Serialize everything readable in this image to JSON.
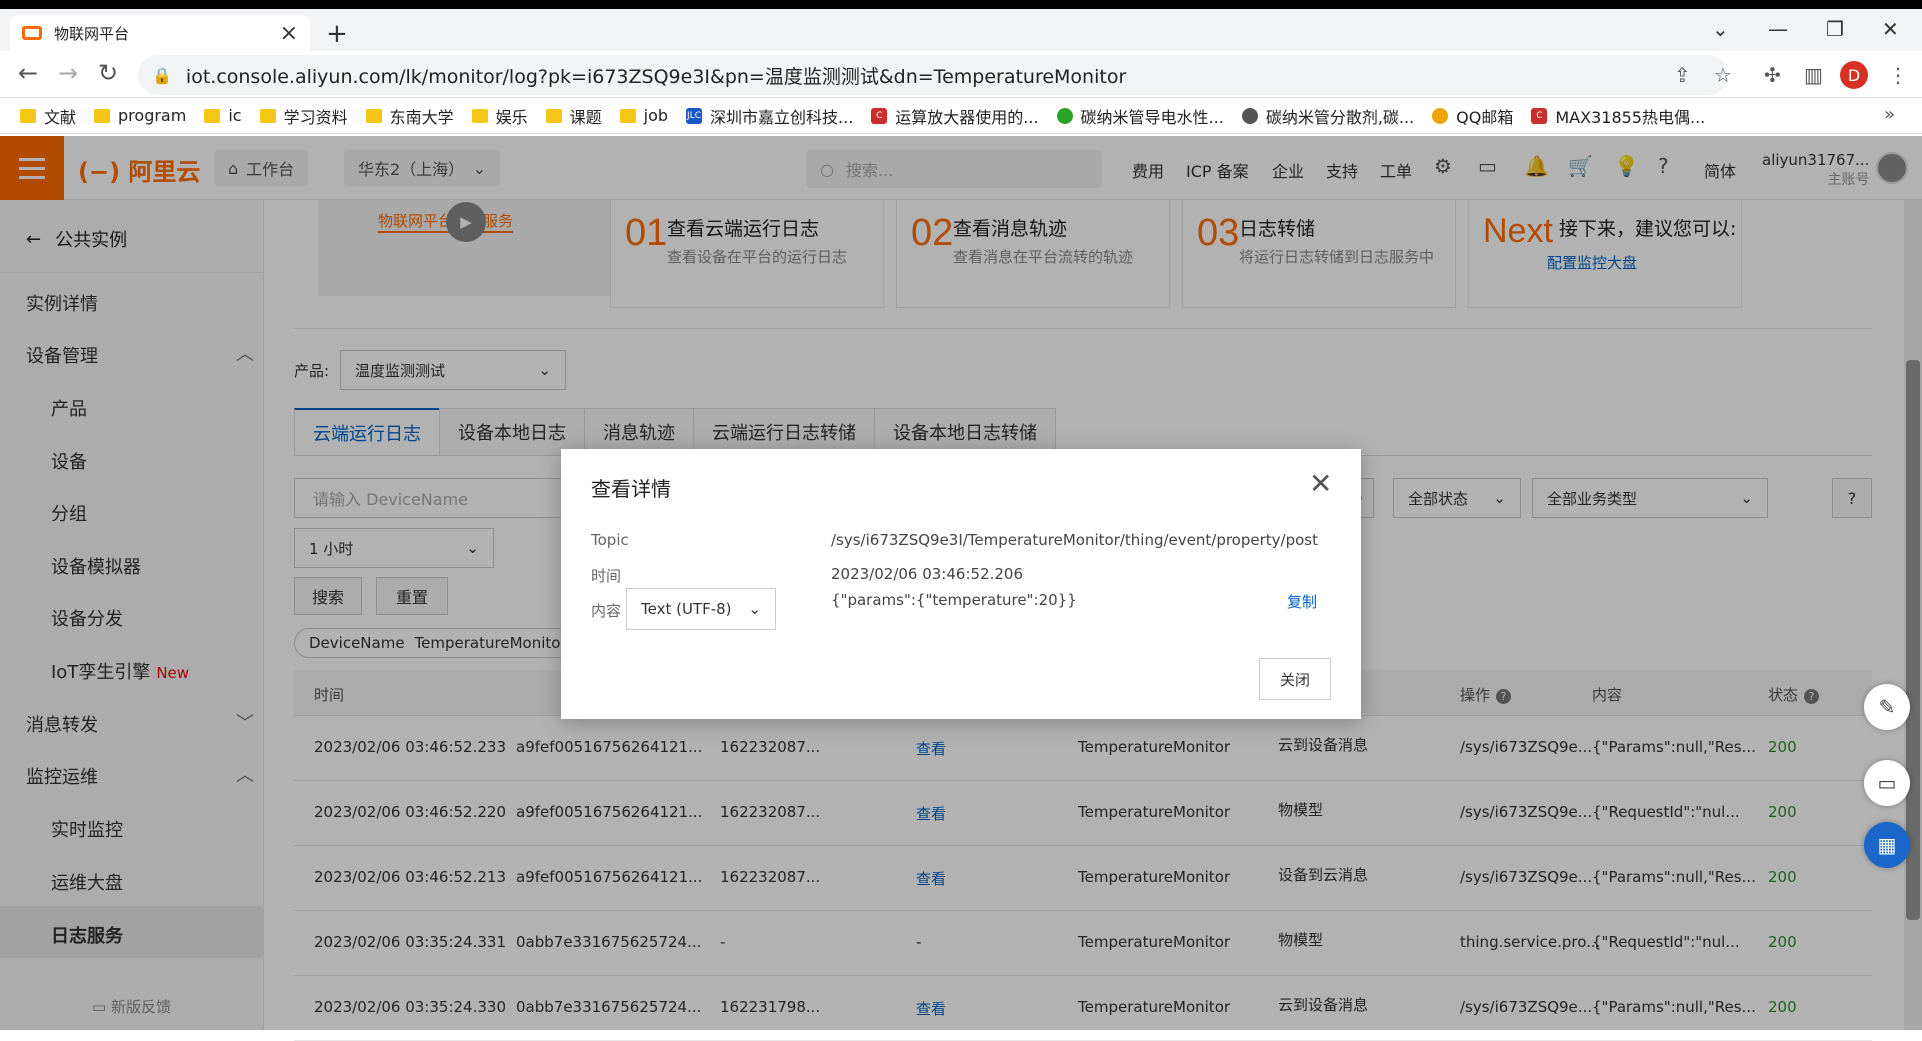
{
  "browser": {
    "tab_title": "物联网平台",
    "url": "iot.console.aliyun.com/lk/monitor/log?pk=i673ZSQ9e3I&pn=温度监测测试&dn=TemperatureMonitor",
    "profile_letter": "D"
  },
  "bookmarks": [
    "文献",
    "program",
    "ic",
    "学习资料",
    "东南大学",
    "娱乐",
    "课题",
    "job",
    "深圳市嘉立创科技...",
    "运算放大器使用的...",
    "碳纳米管导电水性...",
    "碳纳米管分散剂,碳...",
    "QQ邮箱",
    "MAX31855热电偶..."
  ],
  "header": {
    "logo": "阿里云",
    "workbench": "工作台",
    "region": "华东2（上海）",
    "search_placeholder": "搜索...",
    "nav": [
      "费用",
      "ICP 备案",
      "企业",
      "支持",
      "工单"
    ],
    "lang": "简体",
    "account": "aliyun31767...",
    "account_type": "主账号"
  },
  "sidebar": {
    "back": "公共实例",
    "items": [
      "实例详情",
      "设备管理",
      "产品",
      "设备",
      "分组",
      "设备模拟器",
      "设备分发",
      "IoT孪生引擎",
      "消息转发",
      "监控运维",
      "实时监控",
      "运维大盘",
      "日志服务"
    ],
    "new_tag": "New",
    "feedback": "新版反馈"
  },
  "guide": {
    "video_title": "物联网平台日志服务",
    "steps": [
      {
        "num": "01",
        "title": "查看云端运行日志",
        "desc": "查看设备在平台的运行日志"
      },
      {
        "num": "02",
        "title": "查看消息轨迹",
        "desc": "查看消息在平台流转的轨迹"
      },
      {
        "num": "03",
        "title": "日志转储",
        "desc": "将运行日志转储到日志服务中"
      }
    ],
    "next_num": "Next",
    "next_title": "接下来，建议您可以:",
    "next_link": "配置监控大盘"
  },
  "filters": {
    "product_label": "产品:",
    "product_value": "温度监测测试",
    "tabs": [
      "云端运行日志",
      "设备本地日志",
      "消息轨迹",
      "云端运行日志转储",
      "设备本地日志转储"
    ],
    "device_placeholder": "请输入 DeviceName",
    "time_range": "1 小时",
    "search_btn": "搜索",
    "reset_btn": "重置",
    "status_select": "全部状态",
    "biz_select": "全部业务类型",
    "chip_key": "DeviceName",
    "chip_value": "TemperatureMonitor"
  },
  "table": {
    "headers": [
      "时间",
      "操作",
      "内容",
      "状态"
    ],
    "rows": [
      [
        "2023/02/06 03:46:52.233",
        "a9fef00516756264121...",
        "162232087...",
        "查看",
        "TemperatureMonitor",
        "云到设备消息",
        "/sys/i673ZSQ9e...",
        "{\"Params\":null,\"Res...",
        "200"
      ],
      [
        "2023/02/06 03:46:52.220",
        "a9fef00516756264121...",
        "162232087...",
        "查看",
        "TemperatureMonitor",
        "物模型",
        "/sys/i673ZSQ9e...",
        "{\"RequestId\":\"nul...",
        "200"
      ],
      [
        "2023/02/06 03:46:52.213",
        "a9fef00516756264121...",
        "162232087...",
        "查看",
        "TemperatureMonitor",
        "设备到云消息",
        "/sys/i673ZSQ9e...",
        "{\"Params\":null,\"Res...",
        "200"
      ],
      [
        "2023/02/06 03:35:24.331",
        "0abb7e331675625724...",
        "-",
        "-",
        "TemperatureMonitor",
        "物模型",
        "thing.service.pro...",
        "{\"RequestId\":\"nul...",
        "200"
      ],
      [
        "2023/02/06 03:35:24.330",
        "0abb7e331675625724...",
        "162231798...",
        "查看",
        "TemperatureMonitor",
        "云到设备消息",
        "/sys/i673ZSQ9e...",
        "{\"Params\":null,\"Res...",
        "200"
      ]
    ]
  },
  "modal": {
    "title": "查看详情",
    "topic_label": "Topic",
    "topic_value": "/sys/i673ZSQ9e3I/TemperatureMonitor/thing/event/property/post",
    "time_label": "时间",
    "time_value": "2023/02/06 03:46:52.206",
    "content_label": "内容",
    "encoding": "Text (UTF-8)",
    "content_value": "{\"params\":{\"temperature\":20}}",
    "copy": "复制",
    "close_btn": "关闭"
  }
}
